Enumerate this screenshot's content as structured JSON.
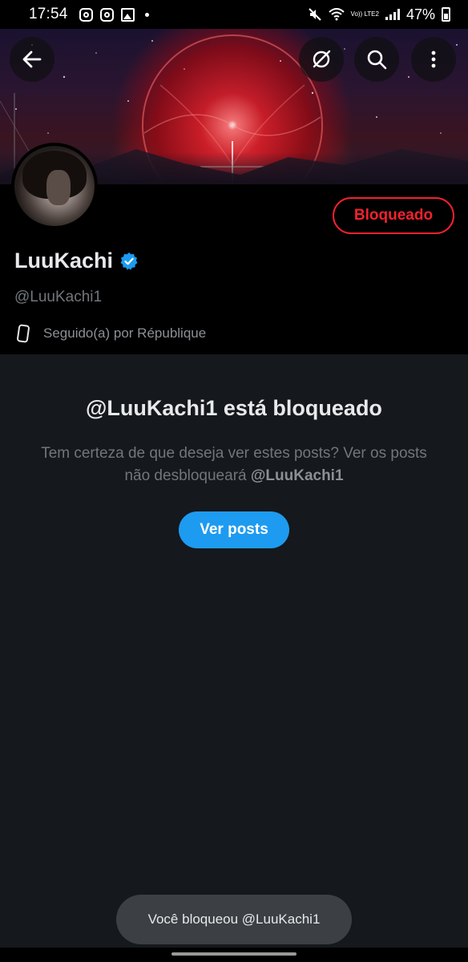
{
  "status_bar": {
    "time": "17:54",
    "left_icons": [
      "instagram-icon",
      "instagram-icon",
      "gallery-icon",
      "dot-icon"
    ],
    "network_label": "Vo)) LTE2",
    "battery": "47%"
  },
  "header": {
    "back_icon": "arrow-left-icon",
    "grok_icon": "grok-icon",
    "search_icon": "search-icon",
    "more_icon": "more-vertical-icon"
  },
  "profile": {
    "display_name": "LuuKachi",
    "handle": "@LuuKachi1",
    "followed_by": "Seguido(a) por République",
    "blocked_button": "Bloqueado",
    "verified": true
  },
  "blocked_panel": {
    "title": "@LuuKachi1 está bloqueado",
    "description_prefix": "Tem certeza de que deseja ver estes posts? Ver os posts não desbloqueará ",
    "description_handle": "@LuuKachi1",
    "view_button": "Ver posts"
  },
  "toast": {
    "message": "Você bloqueou @LuuKachi1"
  },
  "colors": {
    "accent_blue": "#1d9bf0",
    "blocked_red": "#f4212e",
    "background": "#15181c",
    "secondary_text": "#71767b"
  }
}
